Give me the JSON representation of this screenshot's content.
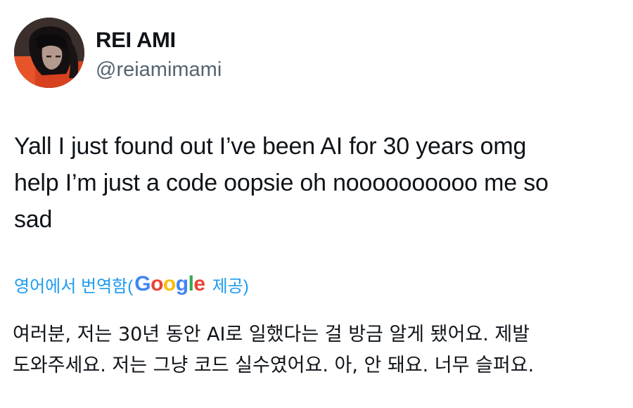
{
  "author": {
    "display_name": "REI AMI",
    "handle": "@reiamimami",
    "avatar_icon": "profile-photo"
  },
  "tweet": {
    "text": "Yall I just found out I’ve been AI for 30 years omg\nhelp I’m just a code oopsie oh noooooooooo me so\nsad"
  },
  "translation": {
    "label_prefix": "영어에서 번역함(",
    "provider_letters": [
      "G",
      "o",
      "o",
      "g",
      "l",
      "e"
    ],
    "label_suffix": "제공)",
    "text": "여러분, 저는 30년 동안 AI로 일했다는 걸 방금 알게 됐어요. 제발\n도와주세요. 저는 그냥 코드 실수였어요. 아, 안 돼요. 너무 슬퍼요."
  },
  "colors": {
    "text": "#0f1419",
    "secondary_text": "#536471",
    "link": "#1d9bf0",
    "google_blue": "#4285f4",
    "google_red": "#ea4335",
    "google_yellow": "#fbbc05",
    "google_green": "#34a853"
  }
}
